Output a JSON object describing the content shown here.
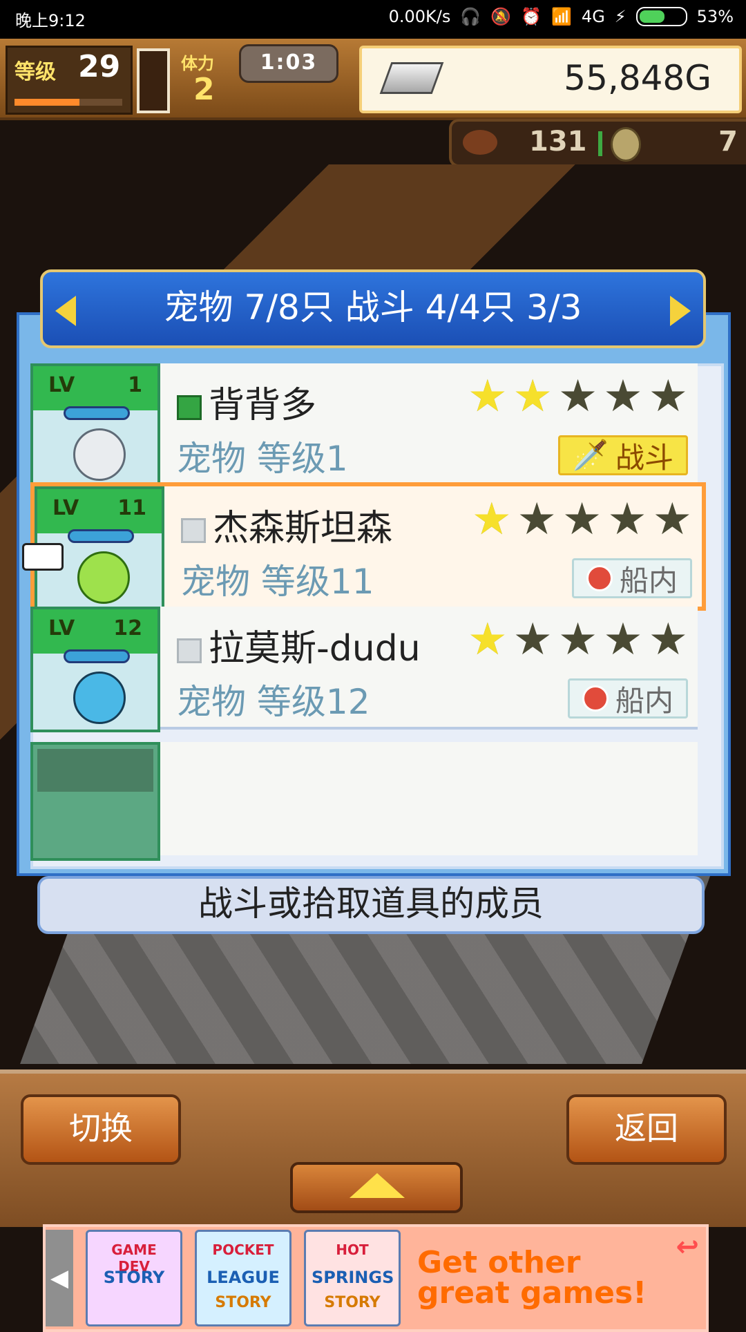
{
  "status_bar": {
    "time": "晚上9:12",
    "network_speed": "0.00K/s",
    "network": "4G",
    "battery": "53%",
    "battery_level": 0.53
  },
  "hud": {
    "level_label": "等级",
    "level_value": "29",
    "stamina_label": "体力",
    "stamina_value": "2",
    "timer": "1:03",
    "gold": "55,848G",
    "food": "131",
    "coins": "7"
  },
  "panel": {
    "header_title": "宠物 7/8只 战斗 4/4只  3/3",
    "rows": [
      {
        "lv": "LV",
        "level": "1",
        "name": "背背多",
        "subtitle": "宠物 等级1",
        "stars_on": 2,
        "badge": "战斗"
      },
      {
        "lv": "LV",
        "level": "11",
        "name": "杰森斯坦森",
        "subtitle": "宠物 等级11",
        "stars_on": 1,
        "badge": "船内"
      },
      {
        "lv": "LV",
        "level": "12",
        "name": "拉莫斯-dudu",
        "subtitle": "宠物 等级12",
        "stars_on": 1,
        "badge": "船内"
      }
    ]
  },
  "info_bar": {
    "text": "战斗或拾取道具的成员"
  },
  "buttons": {
    "switch": "切换",
    "back": "返回"
  },
  "ad": {
    "tiles": [
      {
        "line1": "GAME DEV",
        "line2": "STORY"
      },
      {
        "line1": "POCKET",
        "line2": "LEAGUE",
        "line3": "STORY"
      },
      {
        "line1": "HOT",
        "line2": "SPRINGS",
        "line3": "STORY"
      }
    ],
    "text_line1": "Get other",
    "text_line2": "great games!"
  },
  "colors": {
    "accent_blue": "#2e74dc",
    "selected_border": "#ff9d3a",
    "button_orange": "#e3944b"
  }
}
